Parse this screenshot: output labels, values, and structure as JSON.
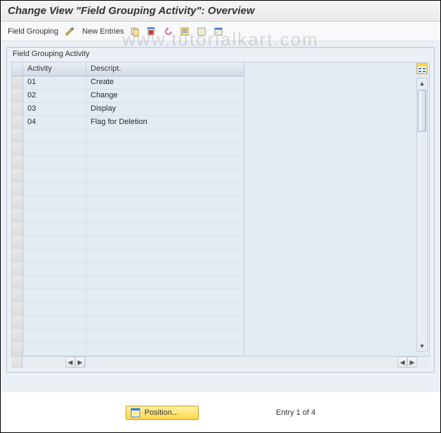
{
  "watermark": "www.tutorialkart.com",
  "title": "Change View \"Field Grouping Activity\": Overview",
  "toolbar": {
    "field_grouping": "Field Grouping",
    "new_entries": "New Entries"
  },
  "group": {
    "label": "Field Grouping Activity",
    "columns": {
      "activity": "Activity",
      "descript": "Descript."
    },
    "rows": [
      {
        "activity": "01",
        "descript": "Create"
      },
      {
        "activity": "02",
        "descript": "Change"
      },
      {
        "activity": "03",
        "descript": "Display"
      },
      {
        "activity": "04",
        "descript": "Flag for Deletion"
      }
    ],
    "empty_row_count": 17
  },
  "footer": {
    "position_label": "Position...",
    "entry_text": "Entry 1 of 4"
  }
}
